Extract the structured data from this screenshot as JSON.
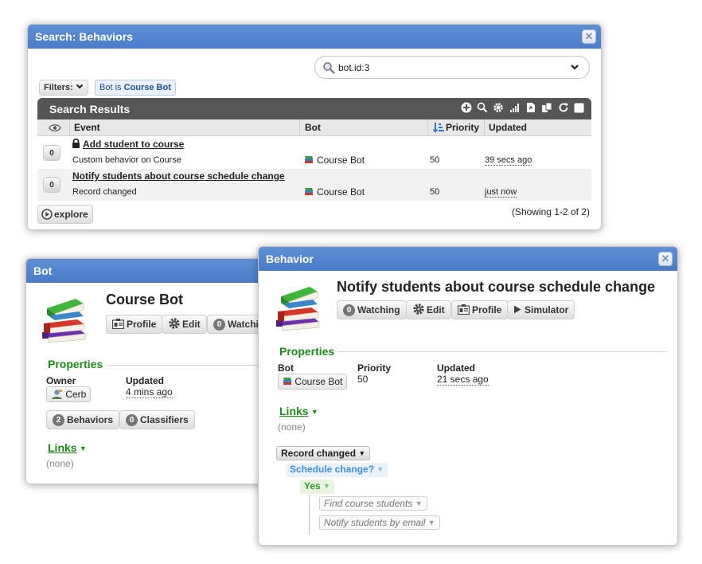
{
  "search_popup": {
    "title": "Search: Behaviors",
    "query": "bot.id:3",
    "filters_label": "Filters:",
    "filter_chip_prefix": "Bot is",
    "filter_chip_value": "Course Bot",
    "results_title": "Search Results",
    "columns": {
      "event": "Event",
      "bot": "Bot",
      "priority": "Priority",
      "updated": "Updated"
    },
    "rows": [
      {
        "watchers": "0",
        "name": "Add student to course",
        "description": "Custom behavior on Course",
        "bot": "Course Bot",
        "priority": "50",
        "updated": "39 secs ago"
      },
      {
        "watchers": "0",
        "name": "Notify students about course schedule change",
        "description": "Record changed",
        "bot": "Course Bot",
        "priority": "50",
        "updated": "just now"
      }
    ],
    "explore_label": "explore",
    "showing": "(Showing 1-2 of 2)"
  },
  "bot_popup": {
    "title": "Bot",
    "name": "Course Bot",
    "profile_label": "Profile",
    "edit_label": "Edit",
    "watch_count": "0",
    "watch_label": "Watchi",
    "properties_title": "Properties",
    "owner_label": "Owner",
    "owner_value": "Cerb",
    "updated_label": "Updated",
    "updated_value": "4 mins ago",
    "behaviors_count": "2",
    "behaviors_label": "Behaviors",
    "classifiers_count": "0",
    "classifiers_label": "Classifiers",
    "links_title": "Links",
    "links_empty": "(none)"
  },
  "behavior_popup": {
    "title": "Behavior",
    "name": "Notify students about course schedule change",
    "watch_count": "0",
    "watch_label": "Watching",
    "edit_label": "Edit",
    "profile_label": "Profile",
    "simulator_label": "Simulator",
    "properties_title": "Properties",
    "bot_label": "Bot",
    "bot_value": "Course Bot",
    "priority_label": "Priority",
    "priority_value": "50",
    "updated_label": "Updated",
    "updated_value": "21 secs ago",
    "links_title": "Links",
    "links_empty": "(none)",
    "tree": {
      "trigger": "Record changed",
      "decision": "Schedule change?",
      "outcome": "Yes",
      "actions": [
        "Find course students",
        "Notify students by email"
      ]
    }
  },
  "colors": {
    "titlebar": "#4a7bc8",
    "section_green": "#1e8a17",
    "decision_blue": "#3a8fd8",
    "outcome_green": "#2f9a2a"
  }
}
